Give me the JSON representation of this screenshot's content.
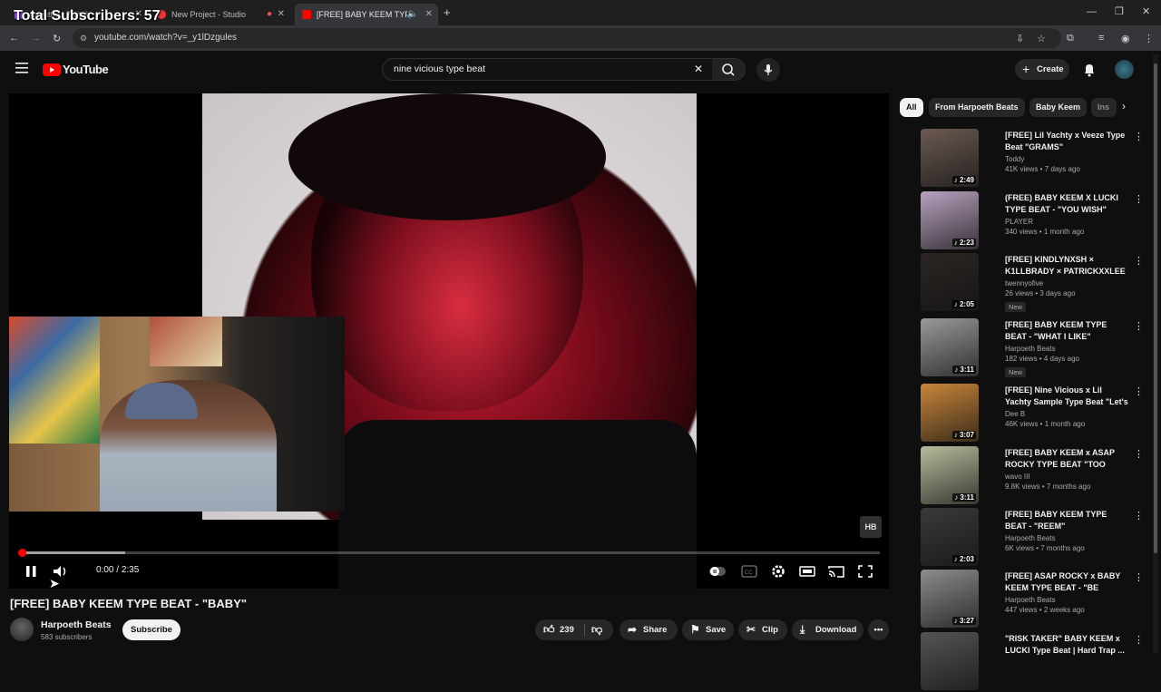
{
  "overlay": {
    "subscriber_count_text": "Total Subscribers: 57"
  },
  "browser": {
    "tabs": [
      {
        "label": "Agent00 - Twitch",
        "color": "#9146ff"
      },
      {
        "label": "New Project - Studio",
        "color": "#e33"
      },
      {
        "label": "[FREE] BABY KEEM TYPE BE",
        "color": "#f00"
      }
    ],
    "url": "youtube.com/watch?v=_y1lDzgules"
  },
  "header": {
    "logo_text": "YouTube",
    "search_value": "nine vicious type beat",
    "create_label": "Create"
  },
  "player": {
    "time_current": "0:00",
    "time_total": "2:35",
    "time_separator": " / ",
    "played_fraction": 0.005,
    "buffered_fraction": 0.122,
    "watermark": "HB"
  },
  "video": {
    "title": "[FREE] BABY KEEM TYPE BEAT - \"BABY\"",
    "channel": "Harpoeth Beats",
    "subscribers": "583 subscribers",
    "subscribe_label": "Subscribe",
    "likes": "239",
    "share_label": "Share",
    "save_label": "Save",
    "clip_label": "Clip",
    "download_label": "Download"
  },
  "sidebar": {
    "chips": [
      "All",
      "From Harpoeth Beats",
      "Baby Keem",
      "Ins"
    ],
    "recommendations": [
      {
        "title": "[FREE] Lil Yachty x Veeze Type Beat \"GRAMS\"",
        "channel": "Toddy",
        "meta": "41K views • 7 days ago",
        "duration": "2:49",
        "badge": "",
        "thumb": "#6b5a52"
      },
      {
        "title": "(FREE) BABY KEEM X LUCKI TYPE BEAT - \"YOU WISH\"",
        "channel": "PLAYER",
        "meta": "340 views • 1 month ago",
        "duration": "2:23",
        "badge": "",
        "thumb": "#b9a2bf"
      },
      {
        "title": "[FREE] KINDLYNXSH × K1LLBRADY × PATRICKXXLEE ...",
        "channel": "twennyofive",
        "meta": "26 views • 3 days ago",
        "duration": "2:05",
        "badge": "New",
        "thumb": "#2b2623"
      },
      {
        "title": "[FREE] BABY KEEM TYPE BEAT - \"WHAT I LIKE\"",
        "channel": "Harpoeth Beats",
        "meta": "182 views • 4 days ago",
        "duration": "3:11",
        "badge": "New",
        "thumb": "#9a9a9a"
      },
      {
        "title": "[FREE] Nine Vicious x Lil Yachty Sample Type Beat \"Let's Fall In...",
        "channel": "Dee B",
        "meta": "46K views • 1 month ago",
        "duration": "3:07",
        "badge": "",
        "thumb": "#c9863a"
      },
      {
        "title": "[FREE] BABY KEEM x ASAP ROCKY TYPE BEAT \"TOO FAST\"",
        "channel": "wavo III",
        "meta": "9.8K views • 7 months ago",
        "duration": "3:11",
        "badge": "",
        "thumb": "#b7bc9c"
      },
      {
        "title": "[FREE] BABY KEEM TYPE BEAT - \"REEM\"",
        "channel": "Harpoeth Beats",
        "meta": "6K views • 7 months ago",
        "duration": "2:03",
        "badge": "",
        "thumb": "#3a3a3a"
      },
      {
        "title": "[FREE] ASAP ROCKY x BABY KEEM TYPE BEAT - \"BE DUMB\"",
        "channel": "Harpoeth Beats",
        "meta": "447 views • 2 weeks ago",
        "duration": "3:27",
        "badge": "",
        "thumb": "#8c8c8c"
      },
      {
        "title": "\"RISK TAKER\" BABY KEEM x LUCKI Type Beat | Hard Trap ...",
        "channel": "",
        "meta": "",
        "duration": "",
        "badge": "",
        "thumb": "#555555"
      }
    ]
  }
}
